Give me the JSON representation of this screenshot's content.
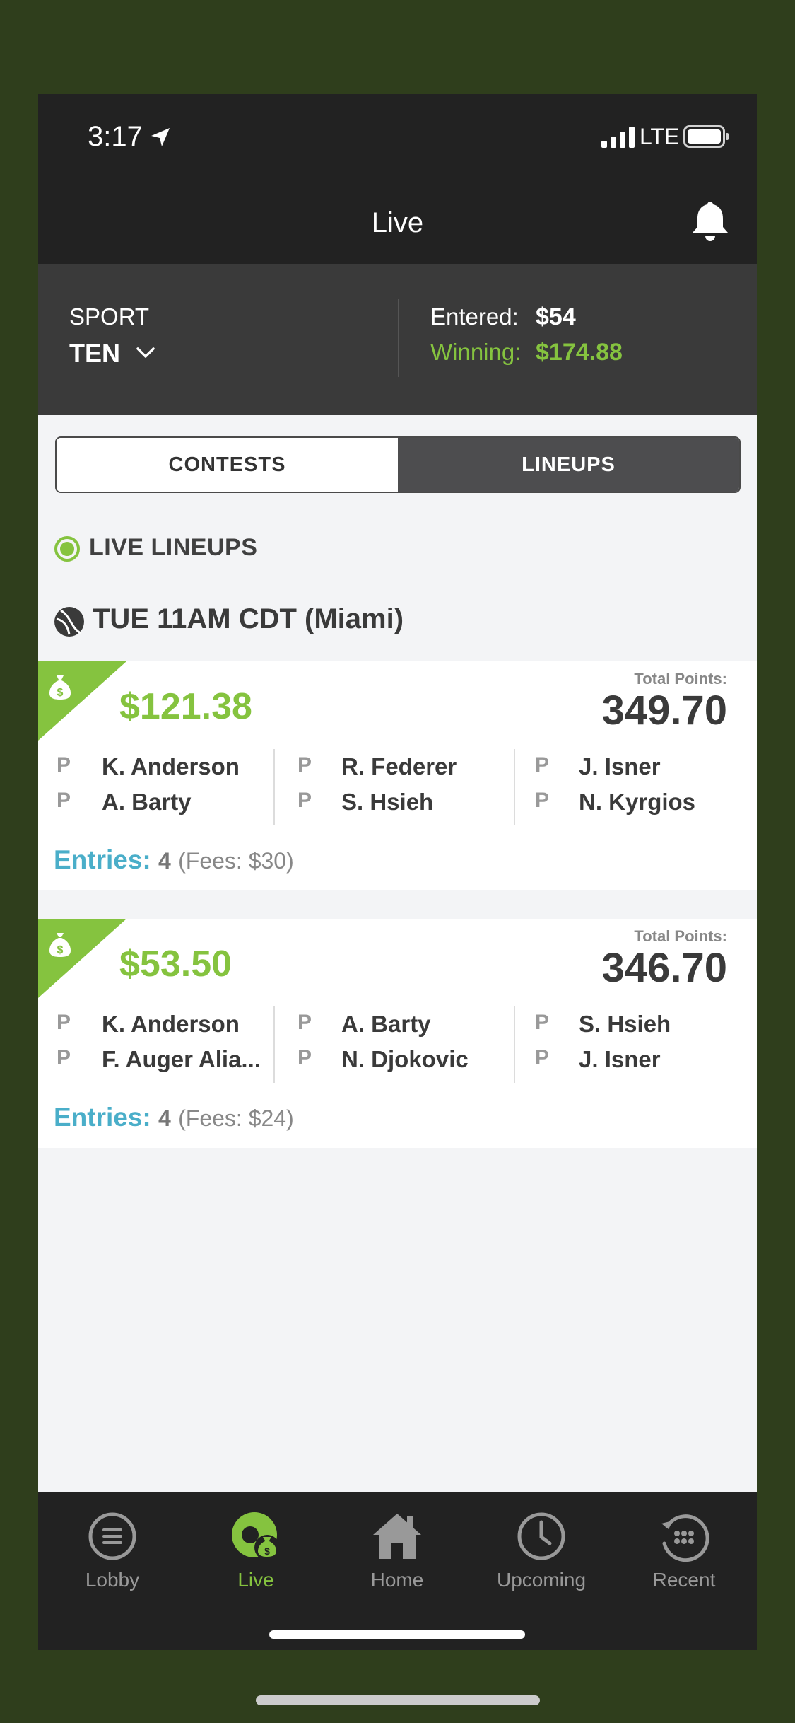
{
  "status": {
    "time": "3:17",
    "network": "LTE"
  },
  "nav": {
    "title": "Live"
  },
  "summary": {
    "sport_label": "SPORT",
    "sport_value": "TEN",
    "entered_label": "Entered:",
    "entered_value": "$54",
    "winning_label": "Winning:",
    "winning_value": "$174.88"
  },
  "tabs": {
    "contests": "CONTESTS",
    "lineups": "LINEUPS",
    "selected": "LINEUPS"
  },
  "section": {
    "live_title": "LIVE LINEUPS",
    "event_title": "TUE 11AM CDT  (Miami)"
  },
  "cards": [
    {
      "amount": "$121.38",
      "total_points_label": "Total Points:",
      "total_points": "349.70",
      "players": [
        {
          "pos": "P",
          "name": "K. Anderson"
        },
        {
          "pos": "P",
          "name": "A. Barty"
        },
        {
          "pos": "P",
          "name": "R. Federer"
        },
        {
          "pos": "P",
          "name": "S. Hsieh"
        },
        {
          "pos": "P",
          "name": "J. Isner"
        },
        {
          "pos": "P",
          "name": "N. Kyrgios"
        }
      ],
      "entries_label": "Entries:",
      "entries_count": "4",
      "fees": "(Fees: $30)"
    },
    {
      "amount": "$53.50",
      "total_points_label": "Total Points:",
      "total_points": "346.70",
      "players": [
        {
          "pos": "P",
          "name": "K. Anderson"
        },
        {
          "pos": "P",
          "name": "F. Auger Alia..."
        },
        {
          "pos": "P",
          "name": "A. Barty"
        },
        {
          "pos": "P",
          "name": "N. Djokovic"
        },
        {
          "pos": "P",
          "name": "S. Hsieh"
        },
        {
          "pos": "P",
          "name": "J. Isner"
        }
      ],
      "entries_label": "Entries:",
      "entries_count": "4",
      "fees": "(Fees: $24)"
    }
  ],
  "tabbar": {
    "items": [
      {
        "label": "Lobby",
        "icon": "menu-circle-icon"
      },
      {
        "label": "Live",
        "icon": "live-money-icon"
      },
      {
        "label": "Home",
        "icon": "home-icon"
      },
      {
        "label": "Upcoming",
        "icon": "clock-icon"
      },
      {
        "label": "Recent",
        "icon": "history-icon"
      }
    ],
    "active": "Live"
  },
  "colors": {
    "accent_green": "#85c33f",
    "entries_blue": "#4aaec9",
    "bar_dark": "#222222"
  }
}
